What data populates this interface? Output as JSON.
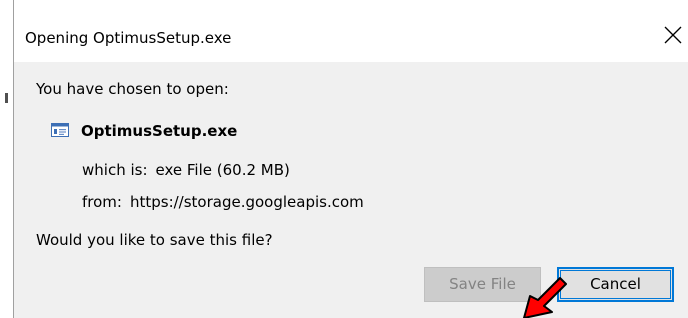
{
  "dialog": {
    "title": "Opening OptimusSetup.exe",
    "close_icon": "close-icon"
  },
  "content": {
    "chosen_label": "You have chosen to open:",
    "file": {
      "icon": "application-file-icon",
      "name": "OptimusSetup.exe"
    },
    "which_label": "which is:",
    "which_value": "exe File (60.2 MB)",
    "from_label": "from:",
    "from_value": "https://storage.googleapis.com",
    "question": "Would you like to save this file?"
  },
  "buttons": {
    "save_label": "Save File",
    "save_enabled": false,
    "cancel_label": "Cancel"
  },
  "colors": {
    "title_background": "#ffffff",
    "dialog_background": "#f0f0f0",
    "focus_border": "#0078d7",
    "pointer_arrow": "#ff0000"
  },
  "overlay": {
    "pointer_icon": "red-arrow-pointer-icon"
  }
}
